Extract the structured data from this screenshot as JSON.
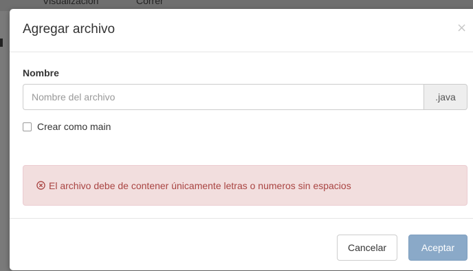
{
  "background": {
    "menu_1": "Visualización",
    "menu_2": "Correr"
  },
  "dialog": {
    "title": "Agregar archivo",
    "close_glyph": "×",
    "field_label": "Nombre",
    "input_value": "",
    "input_placeholder": "Nombre del archivo",
    "extension": ".java",
    "checkbox_label": "Crear como main",
    "checkbox_checked": false,
    "error_message": "El archivo debe de contener únicamente letras o numeros sin espacios",
    "error_icon": "circle-x-icon",
    "cancel_label": "Cancelar",
    "accept_label": "Aceptar"
  },
  "colors": {
    "alert_bg": "#f2dede",
    "alert_text": "#a94442",
    "primary_disabled": "#8aa9c8"
  }
}
